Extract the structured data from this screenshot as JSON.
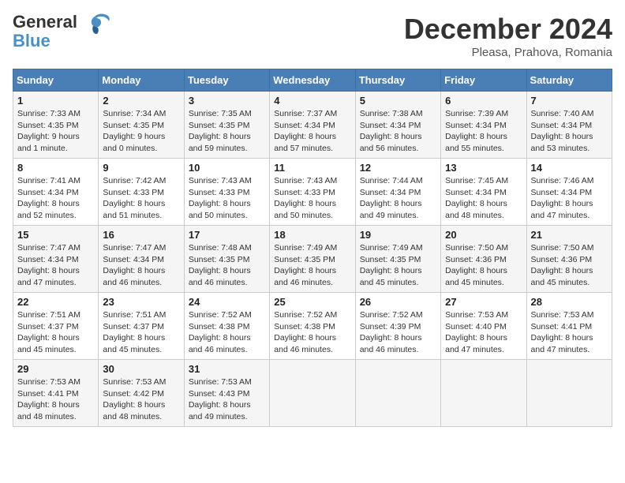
{
  "header": {
    "logo_line1": "General",
    "logo_line2": "Blue",
    "month_title": "December 2024",
    "subtitle": "Pleasa, Prahova, Romania"
  },
  "weekdays": [
    "Sunday",
    "Monday",
    "Tuesday",
    "Wednesday",
    "Thursday",
    "Friday",
    "Saturday"
  ],
  "weeks": [
    [
      {
        "day": "1",
        "sunrise": "Sunrise: 7:33 AM",
        "sunset": "Sunset: 4:35 PM",
        "daylight": "Daylight: 9 hours and 1 minute."
      },
      {
        "day": "2",
        "sunrise": "Sunrise: 7:34 AM",
        "sunset": "Sunset: 4:35 PM",
        "daylight": "Daylight: 9 hours and 0 minutes."
      },
      {
        "day": "3",
        "sunrise": "Sunrise: 7:35 AM",
        "sunset": "Sunset: 4:35 PM",
        "daylight": "Daylight: 8 hours and 59 minutes."
      },
      {
        "day": "4",
        "sunrise": "Sunrise: 7:37 AM",
        "sunset": "Sunset: 4:34 PM",
        "daylight": "Daylight: 8 hours and 57 minutes."
      },
      {
        "day": "5",
        "sunrise": "Sunrise: 7:38 AM",
        "sunset": "Sunset: 4:34 PM",
        "daylight": "Daylight: 8 hours and 56 minutes."
      },
      {
        "day": "6",
        "sunrise": "Sunrise: 7:39 AM",
        "sunset": "Sunset: 4:34 PM",
        "daylight": "Daylight: 8 hours and 55 minutes."
      },
      {
        "day": "7",
        "sunrise": "Sunrise: 7:40 AM",
        "sunset": "Sunset: 4:34 PM",
        "daylight": "Daylight: 8 hours and 53 minutes."
      }
    ],
    [
      {
        "day": "8",
        "sunrise": "Sunrise: 7:41 AM",
        "sunset": "Sunset: 4:34 PM",
        "daylight": "Daylight: 8 hours and 52 minutes."
      },
      {
        "day": "9",
        "sunrise": "Sunrise: 7:42 AM",
        "sunset": "Sunset: 4:33 PM",
        "daylight": "Daylight: 8 hours and 51 minutes."
      },
      {
        "day": "10",
        "sunrise": "Sunrise: 7:43 AM",
        "sunset": "Sunset: 4:33 PM",
        "daylight": "Daylight: 8 hours and 50 minutes."
      },
      {
        "day": "11",
        "sunrise": "Sunrise: 7:43 AM",
        "sunset": "Sunset: 4:33 PM",
        "daylight": "Daylight: 8 hours and 50 minutes."
      },
      {
        "day": "12",
        "sunrise": "Sunrise: 7:44 AM",
        "sunset": "Sunset: 4:34 PM",
        "daylight": "Daylight: 8 hours and 49 minutes."
      },
      {
        "day": "13",
        "sunrise": "Sunrise: 7:45 AM",
        "sunset": "Sunset: 4:34 PM",
        "daylight": "Daylight: 8 hours and 48 minutes."
      },
      {
        "day": "14",
        "sunrise": "Sunrise: 7:46 AM",
        "sunset": "Sunset: 4:34 PM",
        "daylight": "Daylight: 8 hours and 47 minutes."
      }
    ],
    [
      {
        "day": "15",
        "sunrise": "Sunrise: 7:47 AM",
        "sunset": "Sunset: 4:34 PM",
        "daylight": "Daylight: 8 hours and 47 minutes."
      },
      {
        "day": "16",
        "sunrise": "Sunrise: 7:47 AM",
        "sunset": "Sunset: 4:34 PM",
        "daylight": "Daylight: 8 hours and 46 minutes."
      },
      {
        "day": "17",
        "sunrise": "Sunrise: 7:48 AM",
        "sunset": "Sunset: 4:35 PM",
        "daylight": "Daylight: 8 hours and 46 minutes."
      },
      {
        "day": "18",
        "sunrise": "Sunrise: 7:49 AM",
        "sunset": "Sunset: 4:35 PM",
        "daylight": "Daylight: 8 hours and 46 minutes."
      },
      {
        "day": "19",
        "sunrise": "Sunrise: 7:49 AM",
        "sunset": "Sunset: 4:35 PM",
        "daylight": "Daylight: 8 hours and 45 minutes."
      },
      {
        "day": "20",
        "sunrise": "Sunrise: 7:50 AM",
        "sunset": "Sunset: 4:36 PM",
        "daylight": "Daylight: 8 hours and 45 minutes."
      },
      {
        "day": "21",
        "sunrise": "Sunrise: 7:50 AM",
        "sunset": "Sunset: 4:36 PM",
        "daylight": "Daylight: 8 hours and 45 minutes."
      }
    ],
    [
      {
        "day": "22",
        "sunrise": "Sunrise: 7:51 AM",
        "sunset": "Sunset: 4:37 PM",
        "daylight": "Daylight: 8 hours and 45 minutes."
      },
      {
        "day": "23",
        "sunrise": "Sunrise: 7:51 AM",
        "sunset": "Sunset: 4:37 PM",
        "daylight": "Daylight: 8 hours and 45 minutes."
      },
      {
        "day": "24",
        "sunrise": "Sunrise: 7:52 AM",
        "sunset": "Sunset: 4:38 PM",
        "daylight": "Daylight: 8 hours and 46 minutes."
      },
      {
        "day": "25",
        "sunrise": "Sunrise: 7:52 AM",
        "sunset": "Sunset: 4:38 PM",
        "daylight": "Daylight: 8 hours and 46 minutes."
      },
      {
        "day": "26",
        "sunrise": "Sunrise: 7:52 AM",
        "sunset": "Sunset: 4:39 PM",
        "daylight": "Daylight: 8 hours and 46 minutes."
      },
      {
        "day": "27",
        "sunrise": "Sunrise: 7:53 AM",
        "sunset": "Sunset: 4:40 PM",
        "daylight": "Daylight: 8 hours and 47 minutes."
      },
      {
        "day": "28",
        "sunrise": "Sunrise: 7:53 AM",
        "sunset": "Sunset: 4:41 PM",
        "daylight": "Daylight: 8 hours and 47 minutes."
      }
    ],
    [
      {
        "day": "29",
        "sunrise": "Sunrise: 7:53 AM",
        "sunset": "Sunset: 4:41 PM",
        "daylight": "Daylight: 8 hours and 48 minutes."
      },
      {
        "day": "30",
        "sunrise": "Sunrise: 7:53 AM",
        "sunset": "Sunset: 4:42 PM",
        "daylight": "Daylight: 8 hours and 48 minutes."
      },
      {
        "day": "31",
        "sunrise": "Sunrise: 7:53 AM",
        "sunset": "Sunset: 4:43 PM",
        "daylight": "Daylight: 8 hours and 49 minutes."
      },
      null,
      null,
      null,
      null
    ]
  ]
}
